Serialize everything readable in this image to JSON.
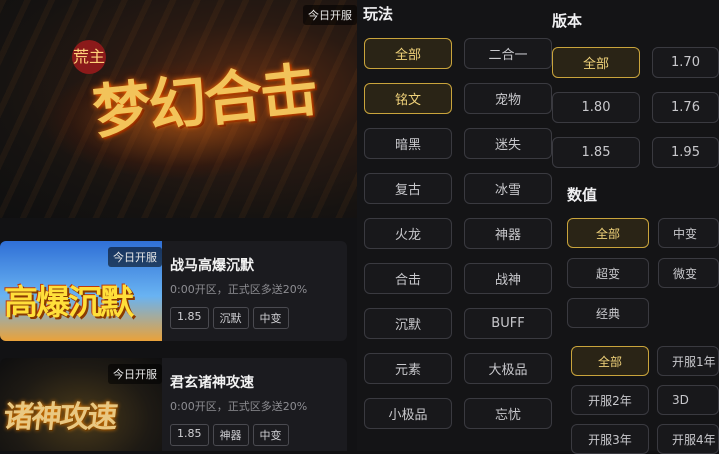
{
  "banner": {
    "today_tag": "今日开服",
    "art_main": "梦幻合击",
    "art_sub": "荒主"
  },
  "games": [
    {
      "today_tag": "今日开服",
      "thumb_art": "高爆沉默",
      "name": "战马高爆沉默",
      "desc": "0:00开区，正式区多送20%",
      "tags": [
        "1.85",
        "沉默",
        "中变"
      ]
    },
    {
      "today_tag": "今日开服",
      "thumb_art": "诸神攻速",
      "name": "君玄诸神攻速",
      "desc": "0:00开区，正式区多送20%",
      "tags": [
        "1.85",
        "神器",
        "中变"
      ]
    }
  ],
  "filters": {
    "gameplay": {
      "title": "玩法",
      "options": [
        "全部",
        "二合一",
        "铭文",
        "宠物",
        "暗黑",
        "迷失",
        "复古",
        "冰雪",
        "火龙",
        "神器",
        "合击",
        "战神",
        "沉默",
        "BUFF",
        "元素",
        "大极品",
        "小极品",
        "忘忧"
      ],
      "active": [
        "全部",
        "铭文"
      ]
    },
    "version": {
      "title": "版本",
      "options": [
        "全部",
        "1.70",
        "1.80",
        "1.76",
        "1.85",
        "1.95"
      ],
      "active": [
        "全部"
      ]
    },
    "value": {
      "title": "数值",
      "options": [
        "全部",
        "中变",
        "超变",
        "微变",
        "经典"
      ],
      "active": [
        "全部"
      ]
    },
    "open_time": {
      "options": [
        "全部",
        "开服1年",
        "开服2年",
        "3D",
        "开服3年",
        "开服4年"
      ],
      "active": [
        "全部"
      ]
    }
  },
  "colors": {
    "accent": "#c9a43c",
    "background": "#111113",
    "card": "#1b1b1f"
  }
}
